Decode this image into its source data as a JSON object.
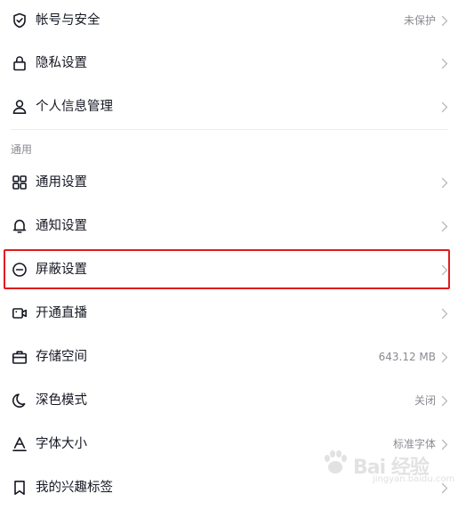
{
  "account_section": {
    "items": [
      {
        "label": "帐号与安全",
        "value": "未保护",
        "icon": "shield-check-icon"
      },
      {
        "label": "隐私设置",
        "value": "",
        "icon": "lock-icon"
      },
      {
        "label": "个人信息管理",
        "value": "",
        "icon": "person-icon"
      }
    ]
  },
  "general_section": {
    "header": "通用",
    "items": [
      {
        "label": "通用设置",
        "value": "",
        "icon": "grid-icon"
      },
      {
        "label": "通知设置",
        "value": "",
        "icon": "bell-icon"
      },
      {
        "label": "屏蔽设置",
        "value": "",
        "icon": "block-icon"
      },
      {
        "label": "开通直播",
        "value": "",
        "icon": "video-camera-icon"
      },
      {
        "label": "存储空间",
        "value": "643.12 MB",
        "icon": "storage-box-icon"
      },
      {
        "label": "深色模式",
        "value": "关闭",
        "icon": "moon-icon"
      },
      {
        "label": "字体大小",
        "value": "标准字体",
        "icon": "font-size-icon"
      },
      {
        "label": "我的兴趣标签",
        "value": "",
        "icon": "bookmark-icon"
      }
    ]
  },
  "highlight_color": "#e01c1c",
  "watermark": {
    "text": "Bai 经验",
    "sub": "jingyan.baidu.com"
  }
}
